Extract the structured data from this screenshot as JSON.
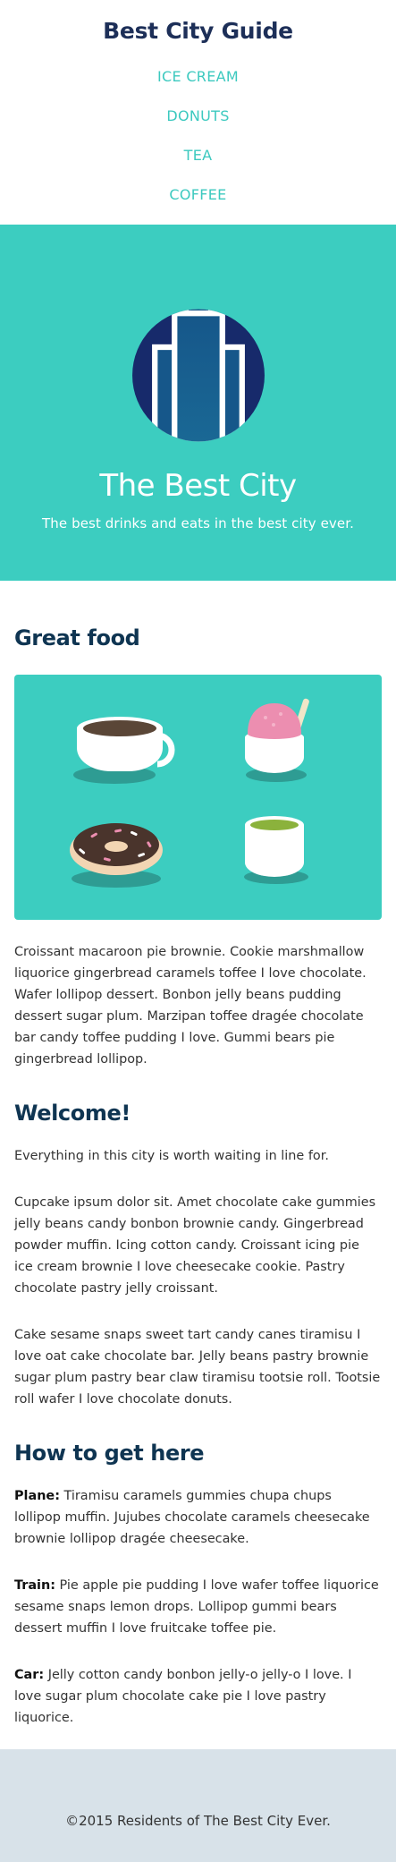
{
  "header": {
    "site_title": "Best City Guide",
    "nav": [
      {
        "label": "ICE CREAM"
      },
      {
        "label": "DONUTS"
      },
      {
        "label": "TEA"
      },
      {
        "label": "COFFEE"
      }
    ]
  },
  "hero": {
    "title": "The Best City",
    "subtitle": "The best drinks and eats in the best city ever."
  },
  "sections": {
    "food": {
      "heading": "Great food",
      "paragraph": "Croissant macaroon pie brownie. Cookie marshmallow liquorice gingerbread caramels toffee I love chocolate. Wafer lollipop dessert. Bonbon jelly beans pudding dessert sugar plum. Marzipan toffee dragée chocolate bar candy toffee pudding I love. Gummi bears pie gingerbread lollipop."
    },
    "welcome": {
      "heading": "Welcome!",
      "paragraphs": [
        "Everything in this city is worth waiting in line for.",
        "Cupcake ipsum dolor sit. Amet chocolate cake gummies jelly beans candy bonbon brownie candy. Gingerbread powder muffin. Icing cotton candy. Croissant icing pie ice cream brownie I love cheesecake cookie. Pastry chocolate pastry jelly croissant.",
        "Cake sesame snaps sweet tart candy canes tiramisu I love oat cake chocolate bar. Jelly beans pastry brownie sugar plum pastry bear claw tiramisu tootsie roll. Tootsie roll wafer I love chocolate donuts."
      ]
    },
    "directions": {
      "heading": "How to get here",
      "items": [
        {
          "mode": "Plane:",
          "text": " Tiramisu caramels gummies chupa chups lollipop muffin. Jujubes chocolate caramels cheesecake brownie lollipop dragée cheesecake."
        },
        {
          "mode": "Train:",
          "text": " Pie apple pie pudding I love wafer toffee liquorice sesame snaps lemon drops. Lollipop gummi bears dessert muffin I love fruitcake toffee pie."
        },
        {
          "mode": "Car:",
          "text": " Jelly cotton candy bonbon jelly-o jelly-o I love. I love sugar plum chocolate cake pie I love pastry liquorice."
        }
      ]
    }
  },
  "footer": {
    "copyright": "©2015 Residents of The Best City Ever."
  },
  "colors": {
    "brand_navy": "#1d2f58",
    "teal": "#3ccdc0",
    "nav_teal": "#3cc9bf",
    "heading": "#0f3552",
    "footer_bg": "#d8e2e9"
  },
  "icons": [
    "city-skyline-logo-icon",
    "coffee-cup-icon",
    "ice-cream-cup-icon",
    "donut-icon",
    "tea-cup-icon"
  ]
}
